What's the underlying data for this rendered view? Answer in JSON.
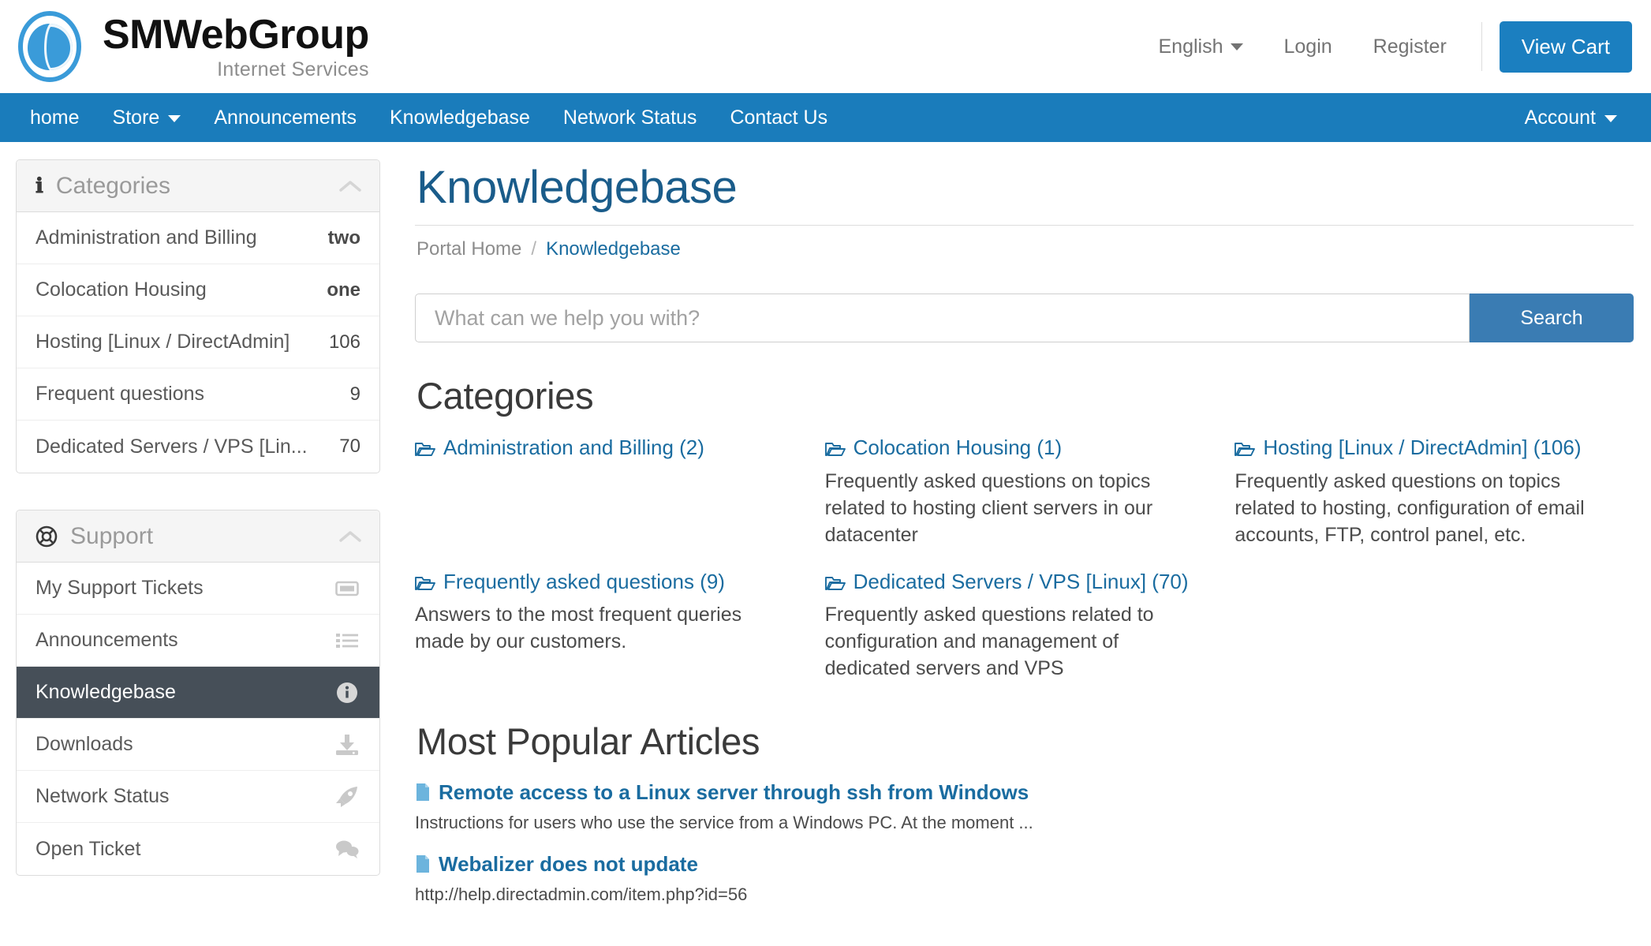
{
  "header": {
    "brand_name": "SMWebGroup",
    "brand_subtitle": "Internet Services",
    "language": "English",
    "login": "Login",
    "register": "Register",
    "view_cart": "View Cart"
  },
  "navbar": {
    "items": [
      {
        "label": "home",
        "has_caret": false
      },
      {
        "label": "Store",
        "has_caret": true
      },
      {
        "label": "Announcements",
        "has_caret": false
      },
      {
        "label": "Knowledgebase",
        "has_caret": false
      },
      {
        "label": "Network Status",
        "has_caret": false
      },
      {
        "label": "Contact Us",
        "has_caret": false
      }
    ],
    "account": "Account"
  },
  "sidebar": {
    "categories_panel": {
      "title": "Categories",
      "icon": "info-icon",
      "items": [
        {
          "label": "Administration and Billing",
          "count": "two",
          "is_word": true
        },
        {
          "label": "Colocation Housing",
          "count": "one",
          "is_word": true
        },
        {
          "label": "Hosting [Linux / DirectAdmin]",
          "count": "106",
          "is_word": false
        },
        {
          "label": "Frequent questions",
          "count": "9",
          "is_word": false
        },
        {
          "label": "Dedicated Servers / VPS [Lin...",
          "count": "70",
          "is_word": false
        }
      ]
    },
    "support_panel": {
      "title": "Support",
      "icon": "lifebuoy-icon",
      "items": [
        {
          "label": "My Support Tickets",
          "icon": "ticket-icon",
          "active": false
        },
        {
          "label": "Announcements",
          "icon": "list-icon",
          "active": false
        },
        {
          "label": "Knowledgebase",
          "icon": "info-circle-icon",
          "active": true
        },
        {
          "label": "Downloads",
          "icon": "download-icon",
          "active": false
        },
        {
          "label": "Network Status",
          "icon": "rocket-icon",
          "active": false
        },
        {
          "label": "Open Ticket",
          "icon": "comments-icon",
          "active": false
        }
      ]
    }
  },
  "main": {
    "page_title": "Knowledgebase",
    "breadcrumb": {
      "home": "Portal Home",
      "separator": "/",
      "current": "Knowledgebase"
    },
    "search": {
      "placeholder": "What can we help you with?",
      "value": "",
      "button": "Search"
    },
    "categories_heading": "Categories",
    "categories": [
      {
        "title": "Administration and Billing (2)",
        "description": ""
      },
      {
        "title": "Colocation Housing (1)",
        "description": "Frequently asked questions on topics related to hosting client servers in our datacenter"
      },
      {
        "title": "Hosting [Linux / DirectAdmin] (106)",
        "description": "Frequently asked questions on topics related to hosting, configuration of email accounts, FTP, control panel, etc."
      },
      {
        "title": "Frequently asked questions (9)",
        "description": "Answers to the most frequent queries made by our customers."
      },
      {
        "title": "Dedicated Servers / VPS [Linux] (70)",
        "description": "Frequently asked questions related to configuration and management of dedicated servers and VPS"
      }
    ],
    "popular_heading": "Most Popular Articles",
    "popular_articles": [
      {
        "title": "Remote access to a Linux server through ssh from Windows",
        "excerpt": "Instructions for users who use the service from a Windows PC. At the moment ..."
      },
      {
        "title": "Webalizer does not update",
        "excerpt": "http://help.directadmin.com/item.php?id=56"
      }
    ]
  },
  "colors": {
    "navbar_blue": "#1a7cbb",
    "brand_blue": "#1b7fc0",
    "link_blue": "#1a6ca0",
    "title_blue": "#1a5c8a",
    "search_button": "#3a7cb3",
    "active_slate": "#464f58",
    "doc_icon_blue": "#6cb4dd"
  }
}
